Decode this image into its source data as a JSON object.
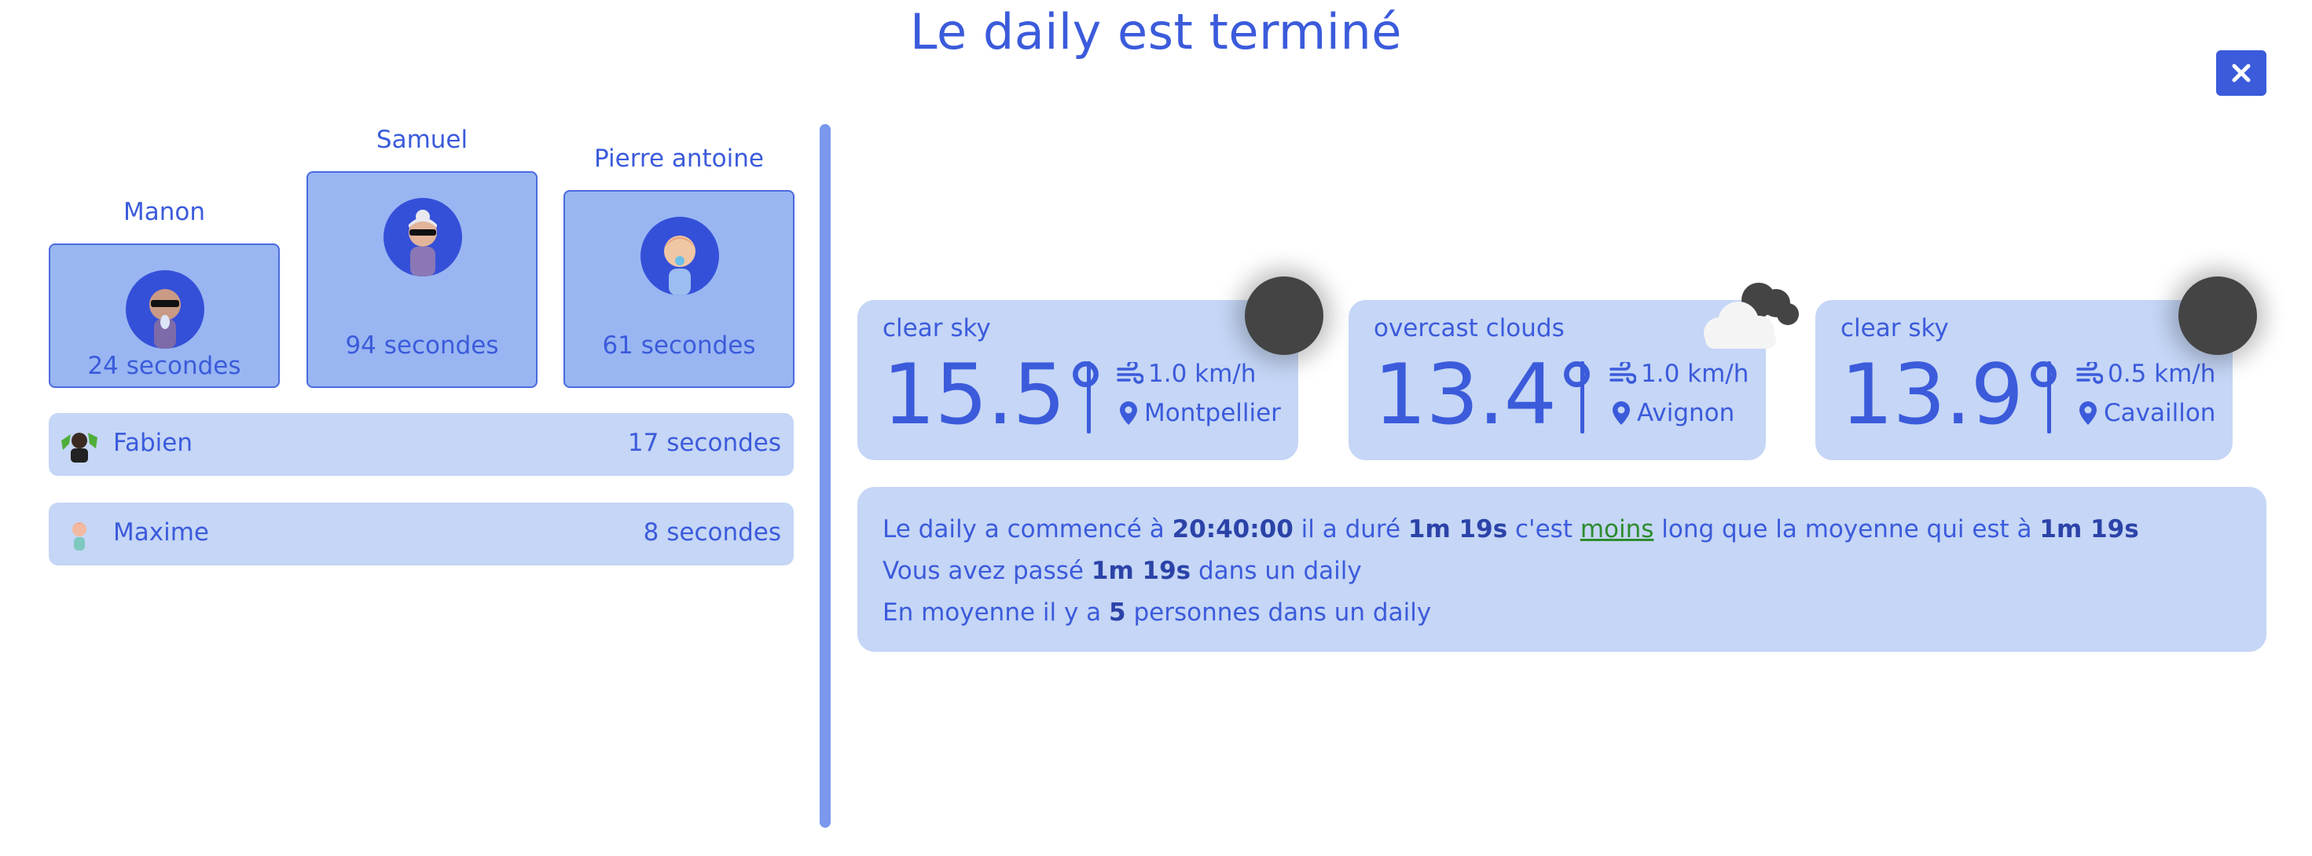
{
  "title": "Le daily est terminé",
  "close_label": "close",
  "podium": [
    {
      "name": "Manon",
      "time": "24 secondes",
      "avatar": "bald-sunglasses-avatar"
    },
    {
      "name": "Samuel",
      "time": "94 secondes",
      "avatar": "grandma-sunglasses-avatar"
    },
    {
      "name": "Pierre antoine",
      "time": "61 secondes",
      "avatar": "baby-pacifier-avatar"
    }
  ],
  "list": [
    {
      "name": "Fabien",
      "time": "17 secondes",
      "avatar": "photo-avatar"
    },
    {
      "name": "Maxime",
      "time": "8 secondes",
      "avatar": "cartoon-avatar"
    }
  ],
  "weather": [
    {
      "desc": "clear sky",
      "temp": "15.5°",
      "wind": "1.0 km/h",
      "city": "Montpellier",
      "icon": "sun-icon"
    },
    {
      "desc": "overcast clouds",
      "temp": "13.4°",
      "wind": "1.0 km/h",
      "city": "Avignon",
      "icon": "cloud-icon"
    },
    {
      "desc": "clear sky",
      "temp": "13.9°",
      "wind": "0.5 km/h",
      "city": "Cavaillon",
      "icon": "sun-icon"
    }
  ],
  "summary": {
    "line1_a": "Le daily a commencé à ",
    "start_time": "20:40:00",
    "line1_b": " il a duré ",
    "duration": "1m 19s",
    "line1_c": " c'est ",
    "comparison": "moins",
    "line1_d": " long que la moyenne qui est à ",
    "average": "1m 19s",
    "line2_a": "Vous avez passé ",
    "total_time": "1m 19s",
    "line2_b": " dans un daily",
    "line3_a": "En moyenne il y a ",
    "avg_people": "5",
    "line3_b": " personnes dans un daily"
  },
  "colors": {
    "accent": "#3b5bdb",
    "card": "#c5d6f6",
    "podium": "#99b6f2",
    "link": "#2e8b2e"
  }
}
